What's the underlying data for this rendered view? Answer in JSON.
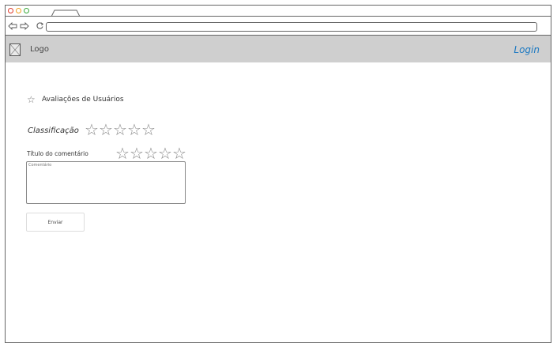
{
  "browser": {
    "url": ""
  },
  "header": {
    "logo": "Logo",
    "login": "Login"
  },
  "main": {
    "section_title": "Avaliações de Usuários",
    "rating_label": "Classificação",
    "rating_stars": 5,
    "comment_title_label": "Título do comentário",
    "comment_stars": 5,
    "comment_placeholder": "Comentário",
    "send_button": "Enviar"
  },
  "colors": {
    "header_bg": "#cfcfcf",
    "login_link": "#1a78c2"
  }
}
